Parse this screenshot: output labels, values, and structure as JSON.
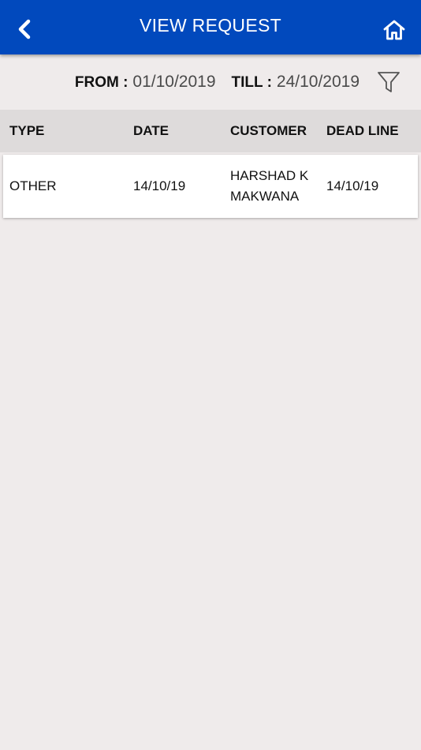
{
  "header": {
    "title": "VIEW REQUEST",
    "back_icon": "chevron-left-icon",
    "home_icon": "home-icon"
  },
  "filter": {
    "from_label": "FROM :",
    "from_value": "01/10/2019",
    "till_label": "TILL :",
    "till_value": "24/10/2019",
    "filter_icon": "funnel-icon"
  },
  "table": {
    "columns": [
      "TYPE",
      "DATE",
      "CUSTOMER",
      "DEAD LINE"
    ],
    "rows": [
      {
        "type": "OTHER",
        "date": "14/10/19",
        "customer": "HARSHAD K MAKWANA",
        "deadline": "14/10/19"
      }
    ]
  },
  "colors": {
    "header_bg": "#0149bd",
    "page_bg": "#efebeb",
    "table_header_bg": "#dedbdb",
    "row_bg": "#ffffff"
  }
}
